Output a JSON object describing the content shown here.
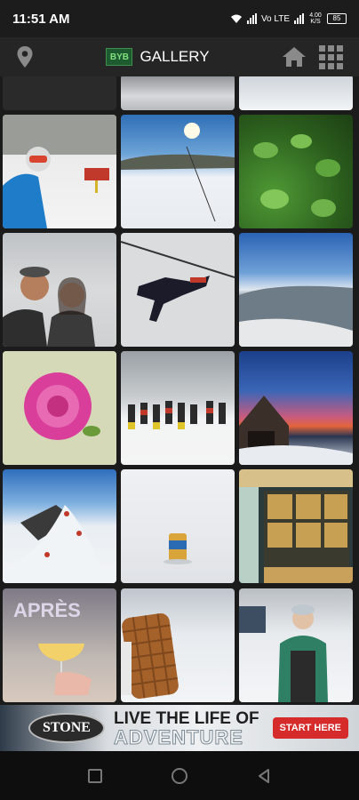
{
  "status_bar": {
    "time": "11:51 AM",
    "network_label": "Vo LTE",
    "speed": "4.00 K/S",
    "battery": "85"
  },
  "app_bar": {
    "logo_text": "BYB",
    "title": "GALLERY",
    "icons": [
      "location-pin-icon",
      "home-icon",
      "grid-menu-icon"
    ]
  },
  "gallery": {
    "photos": [
      "partial-dark-photo",
      "partial-ski-lift-photo",
      "partial-snow-photo",
      "skier-blue-jacket-photo",
      "ski-slope-sun-photo",
      "green-leaves-photo",
      "couple-selfie-photo",
      "ski-lift-rider-photo",
      "mountain-valley-view-photo",
      "pink-flower-cake-photo",
      "kids-ski-class-photo",
      "covered-bridge-sunset-photo",
      "snow-slide-photo",
      "can-in-snow-photo",
      "lodge-window-photo",
      "apres-cocktail-photo",
      "waffle-photo",
      "woman-in-snow-photo"
    ]
  },
  "ad": {
    "logo": "STONE",
    "line1": "LIVE THE LIFE OF",
    "line2": "ADVENTURE",
    "cta": "START HERE"
  },
  "colors": {
    "app_bar": "#252525",
    "background": "#1b1b1b",
    "cta": "#d62b2b"
  }
}
